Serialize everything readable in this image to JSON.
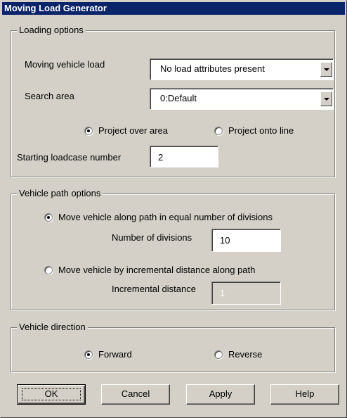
{
  "window": {
    "title": "Moving Load Generator"
  },
  "loading": {
    "legend": "Loading options",
    "vehicle_label": "Moving vehicle load",
    "vehicle_value": "No load attributes present",
    "search_label": "Search area",
    "search_value": "0:Default",
    "project_area_label": "Project over area",
    "project_line_label": "Project onto line",
    "project_selected": "area",
    "start_label": "Starting loadcase number",
    "start_value": "2"
  },
  "path": {
    "legend": "Vehicle path options",
    "equal_label": "Move vehicle along path in equal number of divisions",
    "divisions_label": "Number of divisions",
    "divisions_value": "10",
    "incremental_label": "Move vehicle by incremental distance along path",
    "distance_label": "Incremental distance",
    "distance_value": "1",
    "selected": "equal"
  },
  "direction": {
    "legend": "Vehicle direction",
    "forward_label": "Forward",
    "reverse_label": "Reverse",
    "selected": "forward"
  },
  "buttons": {
    "ok": "OK",
    "cancel": "Cancel",
    "apply": "Apply",
    "help": "Help"
  },
  "colors": {
    "titlebar": "#0a246a",
    "face": "#d4d0c8"
  }
}
